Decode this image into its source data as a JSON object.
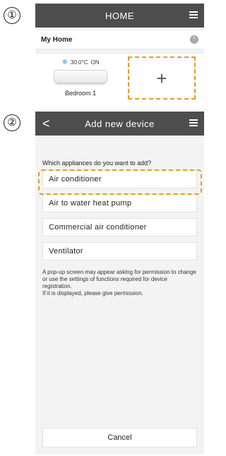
{
  "steps": [
    "①",
    "②"
  ],
  "screen1": {
    "header_title": "HOME",
    "home_label": "My Home",
    "device": {
      "temperature": "30.0°C",
      "power": "ON",
      "name": "Bedroom 1"
    },
    "add_symbol": "+"
  },
  "screen2": {
    "back_symbol": "<",
    "header_title": "Add new device",
    "question": "Which appliances do you want to add?",
    "options": [
      "Air conditioner",
      "Air to water heat pump",
      "Commercial air conditioner",
      "Ventilator"
    ],
    "note_lines": [
      "A pop-up screen may appear asking for permission to change or use the settings of functions required for device registration.",
      "If it is displayed, please give permission."
    ],
    "cancel_label": "Cancel"
  },
  "colors": {
    "header": "#4d4d4d",
    "highlight": "#e79a2b",
    "snowflake": "#3a9fd9"
  }
}
